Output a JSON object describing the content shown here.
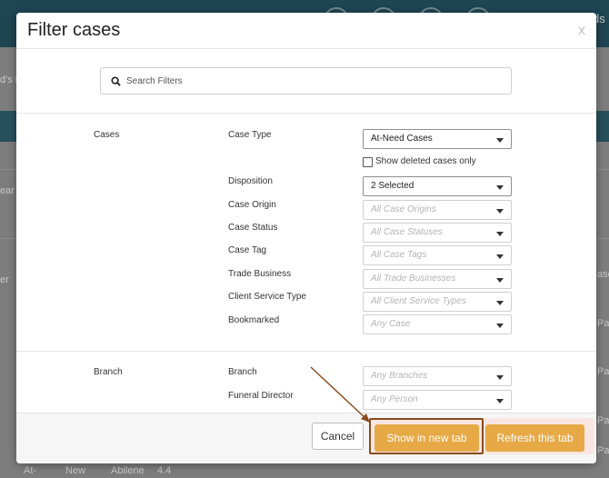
{
  "background": {
    "fragment_top_right": "ds",
    "fragment_left_1": "d's l",
    "fragment_left_2": "ear",
    "fragment_left_3": "er",
    "fragment_right_1": "ase",
    "fragment_right_2": "Passa",
    "fragment_right_3": "Passa",
    "fragment_right_4": "Passa",
    "fragment_right_5": "Passa",
    "fragment_bottom_1": "At-",
    "fragment_bottom_2": "New",
    "fragment_bottom_3": "Abilene",
    "fragment_bottom_4": "4.4"
  },
  "modal": {
    "title": "Filter cases",
    "close_label": "x",
    "search": {
      "placeholder": "Search Filters",
      "value": ""
    }
  },
  "sections": {
    "cases": {
      "label": "Cases",
      "case_type": {
        "label": "Case Type",
        "value": "At-Need Cases"
      },
      "show_deleted": {
        "label": "Show deleted cases only",
        "checked": false
      },
      "disposition": {
        "label": "Disposition",
        "value": "2 Selected"
      },
      "case_origin": {
        "label": "Case Origin",
        "value": "All Case Origins"
      },
      "case_status": {
        "label": "Case Status",
        "value": "All Case Statuses"
      },
      "case_tag": {
        "label": "Case Tag",
        "value": "All Case Tags"
      },
      "trade_business": {
        "label": "Trade Business",
        "value": "All Trade Businesses"
      },
      "client_service_type": {
        "label": "Client Service Type",
        "value": "All Client Service Types"
      },
      "bookmarked": {
        "label": "Bookmarked",
        "value": "Any Case"
      }
    },
    "branch": {
      "label": "Branch",
      "branch": {
        "label": "Branch",
        "value": "Any Branches"
      },
      "funeral_director": {
        "label": "Funeral Director",
        "value": "Any Person"
      }
    }
  },
  "footer": {
    "cancel_label": "Cancel",
    "new_tab_label": "Show in new tab",
    "refresh_label": "Refresh this tab"
  },
  "colors": {
    "accent": "#e7a946",
    "highlight_border": "#8a4a1f",
    "header_bg": "#1d4552"
  },
  "icons": {
    "search": "search-icon",
    "caret": "chevron-down-icon",
    "annotation": "arrow-annotation"
  }
}
